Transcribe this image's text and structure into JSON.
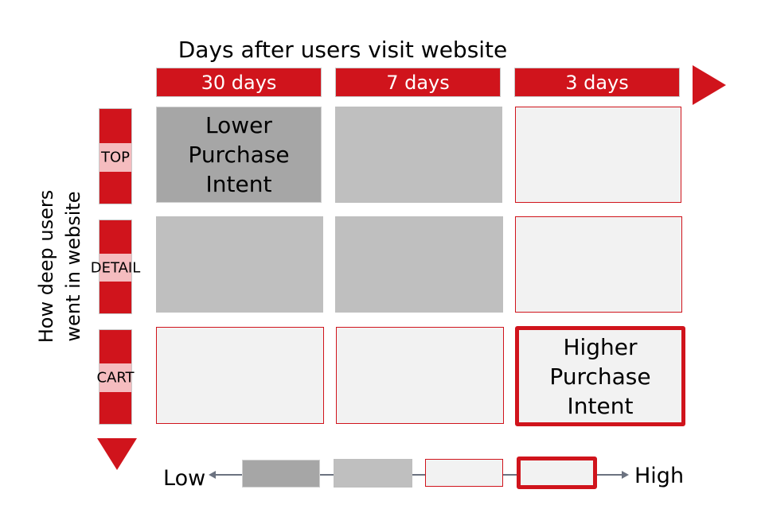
{
  "title": "Days after users visit website",
  "columns": [
    "30 days",
    "7 days",
    "3 days"
  ],
  "y_axis_label": [
    "How deep users",
    "went in website"
  ],
  "rows": [
    "TOP",
    "DETAIL",
    "CART"
  ],
  "cells": [
    [
      {
        "style": "dark",
        "text": [
          "Lower",
          "Purchase",
          "Intent"
        ]
      },
      {
        "style": "mid",
        "text": []
      },
      {
        "style": "light",
        "text": []
      }
    ],
    [
      {
        "style": "mid",
        "text": []
      },
      {
        "style": "mid",
        "text": []
      },
      {
        "style": "light",
        "text": []
      }
    ],
    [
      {
        "style": "light",
        "text": []
      },
      {
        "style": "light",
        "text": []
      },
      {
        "style": "thick",
        "text": [
          "Higher",
          "Purchase",
          "Intent"
        ]
      }
    ]
  ],
  "legend": {
    "low": "Low",
    "high": "High",
    "scale": [
      "dark",
      "mid",
      "light",
      "thick"
    ]
  },
  "colors": {
    "red": "#d0141c",
    "dark_gray": "#a6a6a6",
    "mid_gray": "#bfbfbf",
    "light_fill": "#f2f2f2",
    "pink": "#f5bcbf",
    "arrow_line": "#6b7280"
  }
}
